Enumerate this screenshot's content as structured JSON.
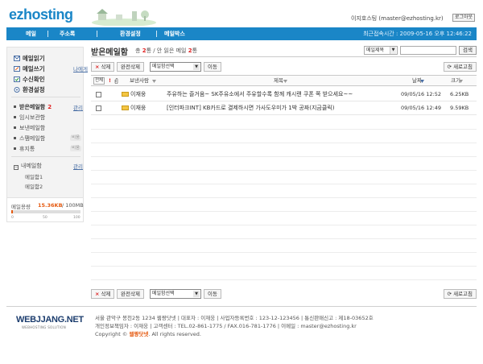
{
  "header": {
    "logo": "ezhosting",
    "user_info": "이지호스팅 (master@ezhosting.kr)",
    "logout": "로그아웃"
  },
  "nav": {
    "items": [
      "메일",
      "주소록",
      "환경설정",
      "메일박스"
    ],
    "last_login": "최근접속시간 : 2009-05-16 오후 12:46:22"
  },
  "sidebar": {
    "main_menu": [
      {
        "label": "메일읽기",
        "link": ""
      },
      {
        "label": "메일쓰기",
        "link": "나에게"
      },
      {
        "label": "수신확인",
        "link": ""
      },
      {
        "label": "환경설정",
        "link": ""
      }
    ],
    "folders": [
      {
        "label": "받은메일함",
        "count": "2",
        "tag": "관리"
      },
      {
        "label": "임시보관함",
        "count": "",
        "tag": ""
      },
      {
        "label": "보낸메일함",
        "count": "",
        "tag": ""
      },
      {
        "label": "스팸메일함",
        "count": "",
        "tag": "비움"
      },
      {
        "label": "휴지통",
        "count": "",
        "tag": "비움"
      }
    ],
    "mailbox_title": "내메일함",
    "mailbox_manage": "관리",
    "mailbox_items": [
      "메일함1",
      "메일함2"
    ],
    "usage": {
      "label": "메일용량",
      "used": "15.36KB",
      "total": "/ 100MB",
      "fraction": 0.02,
      "ticks": [
        "0",
        "50",
        "100"
      ]
    }
  },
  "main": {
    "title": "받은메일함",
    "stats_prefix": "총",
    "total": "2",
    "stats_mid": "통 / 안 읽은 메일",
    "unread": "2",
    "stats_suffix": "통",
    "search": {
      "select_value": "메일제목",
      "button": "검색"
    },
    "toolbar": {
      "delete": "삭제",
      "perm_delete": "완전삭제",
      "move_select": "메일함선택",
      "move": "이동",
      "refresh": "새로고침"
    },
    "columns": {
      "select_all": "전체",
      "important": "!",
      "sender": "보낸사람",
      "subject": "제목",
      "date": "날짜",
      "size": "크기"
    },
    "rows": [
      {
        "sender": "이재웅",
        "subject": "주유하는 즐거움~ SK주유소에서 주유할수록 함께 캐시랜 쿠폰 쪽 받으세요~~",
        "date": "09/05/16 12:52",
        "size": "6.25KB"
      },
      {
        "sender": "이재웅",
        "subject": "[인터파크INT] KB카드로 결제하시면 가사도우미가 1박 공짜(지금클릭)",
        "date": "09/05/16 12:49",
        "size": "9.59KB"
      }
    ]
  },
  "footer": {
    "logo": "WEBJJANG.NET",
    "logo_sub": "WEBHOSTING SOLUTION",
    "line1": "서울 관악구 봉천2동 1234  웹짱닷넷   |   대표자 : 이재웅   |   사업자등록번호 : 123-12-123456   |   통신판매신고 : 제18-03652호",
    "line2": "개인정보책임자 : 이재웅   |   고객센터 : TEL.02-861-1775 / FAX.016-781-1776   |   이메일 : master@ezhosting.kr",
    "copyright_prefix": "Copyright ©",
    "copyright_brand": "웹짱닷넷",
    "copyright_suffix": ". All rights reserved."
  }
}
